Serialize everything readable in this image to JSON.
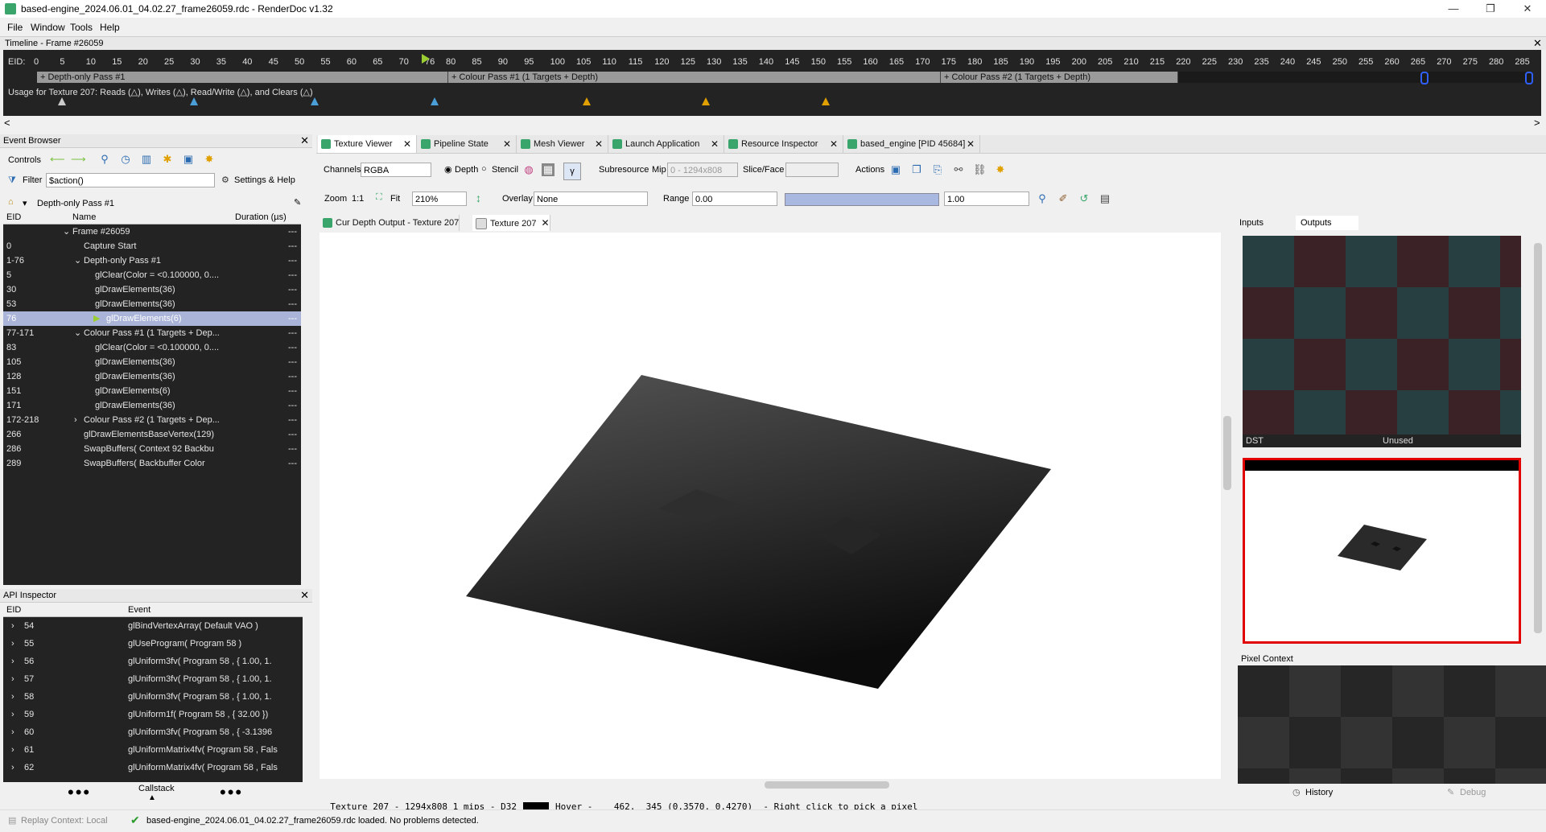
{
  "window": {
    "title": "based-engine_2024.06.01_04.02.27_frame26059.rdc - RenderDoc v1.32",
    "min": "—",
    "max": "❐",
    "close": "✕"
  },
  "menu": [
    "File",
    "Window",
    "Tools",
    "Help"
  ],
  "timeline": {
    "title": "Timeline - Frame #26059",
    "eid_label": "EID:",
    "ticks_a": [
      "0",
      "5",
      "10",
      "15",
      "20",
      "25",
      "30",
      "35",
      "40",
      "45",
      "50",
      "55",
      "60",
      "65",
      "70",
      "76"
    ],
    "ticks_b": [
      "80",
      "85",
      "90",
      "95",
      "100",
      "105",
      "110",
      "115",
      "120",
      "125",
      "130",
      "135",
      "140",
      "145",
      "150",
      "155",
      "160",
      "165",
      "170",
      "175",
      "180",
      "185",
      "190",
      "195",
      "200",
      "205",
      "210",
      "215",
      "220",
      "225",
      "230",
      "235",
      "240",
      "245",
      "250",
      "255",
      "260",
      "265",
      "270",
      "275",
      "280",
      "285"
    ],
    "passes": [
      "+ Depth-only Pass #1",
      "+ Colour Pass #1 (1 Targets + Depth)",
      "+ Colour Pass #2 (1 Targets + Depth)"
    ],
    "usage": "Usage for Texture 207: Reads (△), Writes (△), Read/Write (△), and Clears (△)",
    "left_arrow": "<",
    "right_arrow": ">"
  },
  "event_browser": {
    "title": "Event Browser",
    "controls_label": "Controls",
    "filter_label": "Filter",
    "filter_value": "$action()",
    "settings_label": "Settings & Help",
    "breadcrumb": "Depth-only Pass #1",
    "columns": [
      "EID",
      "Name",
      "Duration (µs)"
    ],
    "rows": [
      {
        "eid": "",
        "name": "Frame #26059",
        "dur": "---",
        "indent": 0,
        "expander": "v"
      },
      {
        "eid": "0",
        "name": "Capture Start",
        "dur": "---",
        "indent": 1,
        "expander": ""
      },
      {
        "eid": "1-76",
        "name": "Depth-only Pass #1",
        "dur": "---",
        "indent": 1,
        "expander": "v"
      },
      {
        "eid": "5",
        "name": "glClear(Color = <0.100000, 0....",
        "dur": "---",
        "indent": 2,
        "expander": ""
      },
      {
        "eid": "30",
        "name": "glDrawElements(36)",
        "dur": "---",
        "indent": 2,
        "expander": ""
      },
      {
        "eid": "53",
        "name": "glDrawElements(36)",
        "dur": "---",
        "indent": 2,
        "expander": ""
      },
      {
        "eid": "76",
        "name": "glDrawElements(6)",
        "dur": "---",
        "indent": 3,
        "expander": "",
        "selected": true
      },
      {
        "eid": "77-171",
        "name": "Colour Pass #1 (1 Targets + Dep...",
        "dur": "---",
        "indent": 1,
        "expander": "v"
      },
      {
        "eid": "83",
        "name": "glClear(Color = <0.100000, 0....",
        "dur": "---",
        "indent": 2,
        "expander": ""
      },
      {
        "eid": "105",
        "name": "glDrawElements(36)",
        "dur": "---",
        "indent": 2,
        "expander": ""
      },
      {
        "eid": "128",
        "name": "glDrawElements(36)",
        "dur": "---",
        "indent": 2,
        "expander": ""
      },
      {
        "eid": "151",
        "name": "glDrawElements(6)",
        "dur": "---",
        "indent": 2,
        "expander": ""
      },
      {
        "eid": "171",
        "name": "glDrawElements(36)",
        "dur": "---",
        "indent": 2,
        "expander": ""
      },
      {
        "eid": "172-218",
        "name": "Colour Pass #2 (1 Targets + Dep...",
        "dur": "---",
        "indent": 1,
        "expander": ">"
      },
      {
        "eid": "266",
        "name": "glDrawElementsBaseVertex(129)",
        "dur": "---",
        "indent": 1,
        "expander": ""
      },
      {
        "eid": "286",
        "name": "SwapBuffers( Context 92 Backbu",
        "dur": "---",
        "indent": 1,
        "expander": ""
      },
      {
        "eid": "289",
        "name": "SwapBuffers( Backbuffer Color",
        "dur": "---",
        "indent": 1,
        "expander": ""
      }
    ]
  },
  "api_inspector": {
    "title": "API Inspector",
    "columns": [
      "EID",
      "Event"
    ],
    "rows": [
      {
        "eid": "54",
        "event": "glBindVertexArray( Default VAO )"
      },
      {
        "eid": "55",
        "event": "glUseProgram( Program 58 )"
      },
      {
        "eid": "56",
        "event": "glUniform3fv( Program 58 , { 1.00, 1."
      },
      {
        "eid": "57",
        "event": "glUniform3fv( Program 58 , { 1.00, 1."
      },
      {
        "eid": "58",
        "event": "glUniform3fv( Program 58 , { 1.00, 1."
      },
      {
        "eid": "59",
        "event": "glUniform1f( Program 58 , { 32.00 })"
      },
      {
        "eid": "60",
        "event": "glUniform3fv( Program 58 , { -3.1396"
      },
      {
        "eid": "61",
        "event": "glUniformMatrix4fv( Program 58 , Fals"
      },
      {
        "eid": "62",
        "event": "glUniformMatrix4fv( Program 58 , Fals"
      }
    ],
    "callstack_label": "Callstack",
    "dots": "•••"
  },
  "main_tabs": [
    {
      "label": "Texture Viewer",
      "active": true
    },
    {
      "label": "Pipeline State"
    },
    {
      "label": "Mesh Viewer"
    },
    {
      "label": "Launch Application"
    },
    {
      "label": "Resource Inspector"
    },
    {
      "label": "based_engine [PID 45684]"
    }
  ],
  "toolbar1": {
    "channels_label": "Channels",
    "channels_value": "RGBA",
    "depth_label": "Depth",
    "stencil_label": "Stencil",
    "gamma": "γ",
    "subresource_label": "Subresource",
    "mip_label": "Mip",
    "mip_value": "0 - 1294x808",
    "slice_label": "Slice/Face",
    "actions_label": "Actions"
  },
  "toolbar2": {
    "zoom_label": "Zoom",
    "zoom_1to1": "1:1",
    "fit_label": "Fit",
    "zoom_value": "210%",
    "overlay_label": "Overlay",
    "overlay_value": "None",
    "range_label": "Range",
    "range_min": "0.00",
    "range_max": "1.00"
  },
  "texture_tabs": [
    {
      "label": "Cur Depth Output - Texture 207"
    },
    {
      "label": "Texture 207",
      "active": true
    }
  ],
  "status_line": "Texture 207 - 1294x808 1 mips - D32",
  "hover_line": "Hover -    462,  345 (0.3570, 0.4270)  - Right click to pick a pixel",
  "side_panel": {
    "tabs": [
      "Inputs",
      "Outputs"
    ],
    "thumb1_left": "DST",
    "thumb1_right": "Unused",
    "pixel_context_title": "Pixel Context",
    "history_label": "History",
    "debug_label": "Debug"
  },
  "statusbar": {
    "replay": "Replay Context: Local",
    "message": "based-engine_2024.06.01_04.02.27_frame26059.rdc loaded. No problems detected."
  },
  "colors": {
    "accent_green": "#3aa56a",
    "selection": "#aab4d8",
    "usage_read": "#4a9fd8",
    "usage_write": "#e0a000",
    "red_border": "#e00000"
  }
}
